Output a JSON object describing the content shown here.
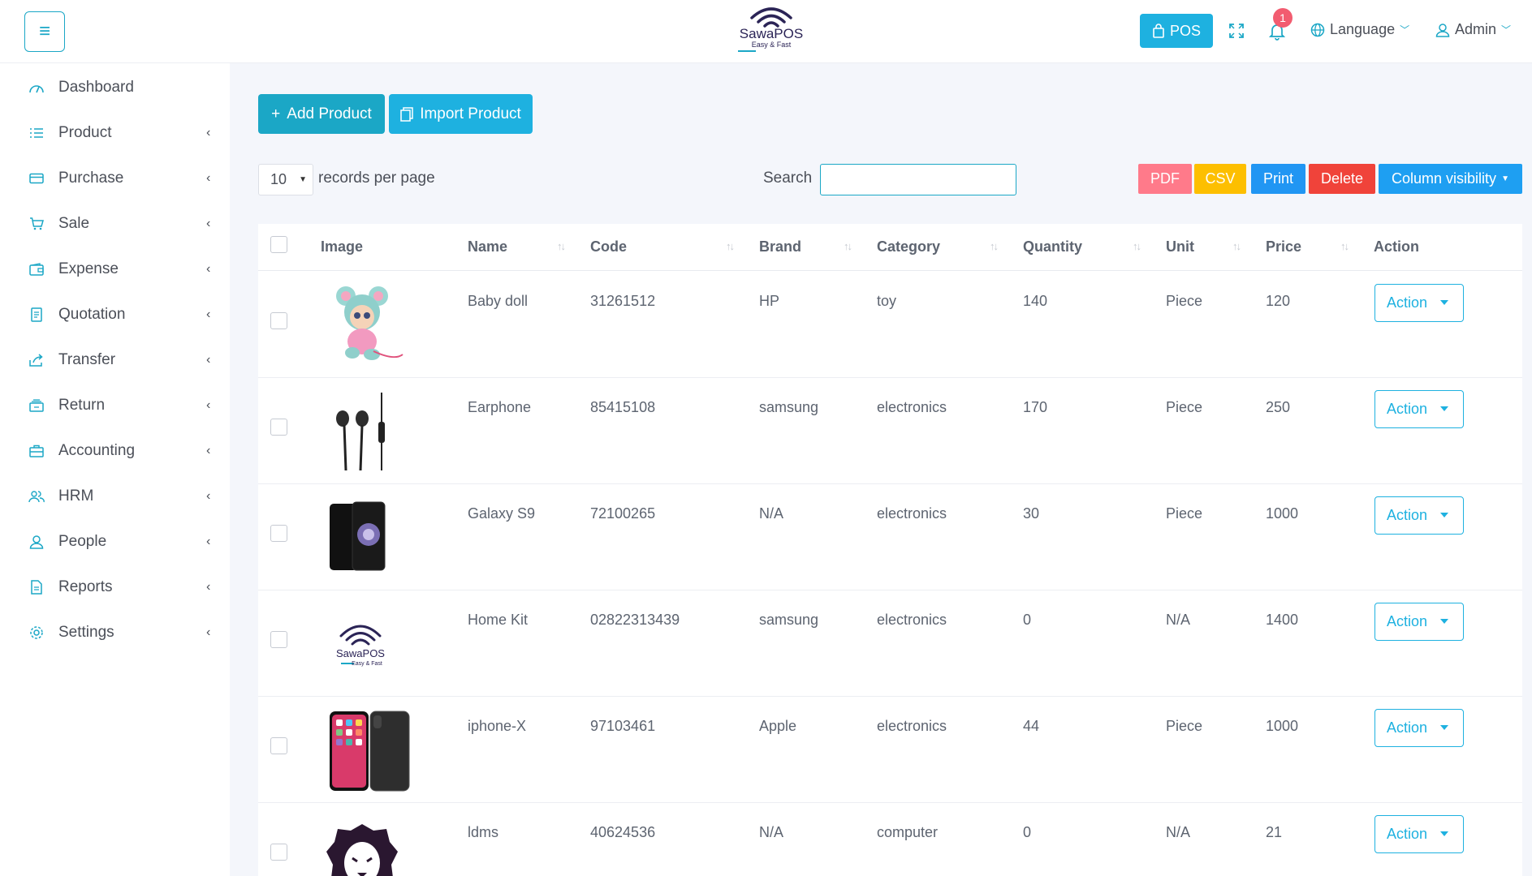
{
  "header": {
    "logo_text": "SawaPOS",
    "logo_tagline": "Easy & Fast",
    "pos_label": "POS",
    "notification_count": "1",
    "language_label": "Language",
    "user_label": "Admin"
  },
  "sidebar": {
    "items": [
      {
        "label": "Dashboard",
        "icon": "dashboard-icon"
      },
      {
        "label": "Product",
        "icon": "list-icon"
      },
      {
        "label": "Purchase",
        "icon": "card-icon"
      },
      {
        "label": "Sale",
        "icon": "cart-icon"
      },
      {
        "label": "Expense",
        "icon": "wallet-icon"
      },
      {
        "label": "Quotation",
        "icon": "document-icon"
      },
      {
        "label": "Transfer",
        "icon": "share-icon"
      },
      {
        "label": "Return",
        "icon": "inbox-icon"
      },
      {
        "label": "Accounting",
        "icon": "briefcase-icon"
      },
      {
        "label": "HRM",
        "icon": "users-icon"
      },
      {
        "label": "People",
        "icon": "user-icon"
      },
      {
        "label": "Reports",
        "icon": "file-icon"
      },
      {
        "label": "Settings",
        "icon": "gear-icon"
      }
    ]
  },
  "toolbar": {
    "add_product": "Add Product",
    "import_product": "Import Product",
    "records_per_page_value": "10",
    "records_per_page_label": "records per page",
    "search_label": "Search",
    "search_value": "",
    "pdf": "PDF",
    "csv": "CSV",
    "print": "Print",
    "delete": "Delete",
    "column_visibility": "Column visibility"
  },
  "table": {
    "headers": {
      "image": "Image",
      "name": "Name",
      "code": "Code",
      "brand": "Brand",
      "category": "Category",
      "quantity": "Quantity",
      "unit": "Unit",
      "price": "Price",
      "action": "Action"
    },
    "rows": [
      {
        "image": "baby-doll-image",
        "name": "Baby doll",
        "code": "31261512",
        "brand": "HP",
        "category": "toy",
        "quantity": "140",
        "unit": "Piece",
        "price": "120",
        "action": "Action"
      },
      {
        "image": "earphone-image",
        "name": "Earphone",
        "code": "85415108",
        "brand": "samsung",
        "category": "electronics",
        "quantity": "170",
        "unit": "Piece",
        "price": "250",
        "action": "Action"
      },
      {
        "image": "galaxy-s9-image",
        "name": "Galaxy S9",
        "code": "72100265",
        "brand": "N/A",
        "category": "electronics",
        "quantity": "30",
        "unit": "Piece",
        "price": "1000",
        "action": "Action"
      },
      {
        "image": "sawapos-logo-image",
        "name": "Home Kit",
        "code": "02822313439",
        "brand": "samsung",
        "category": "electronics",
        "quantity": "0",
        "unit": "N/A",
        "price": "1400",
        "action": "Action"
      },
      {
        "image": "iphone-x-image",
        "name": "iphone-X",
        "code": "97103461",
        "brand": "Apple",
        "category": "electronics",
        "quantity": "44",
        "unit": "Piece",
        "price": "1000",
        "action": "Action"
      },
      {
        "image": "lion-logo-image",
        "name": "ldms",
        "code": "40624536",
        "brand": "N/A",
        "category": "computer",
        "quantity": "0",
        "unit": "N/A",
        "price": "21",
        "action": "Action"
      }
    ]
  },
  "colors": {
    "accent": "#1ba7c6",
    "pos": "#1eb1e0",
    "pdf": "#ff7a8a",
    "csv": "#fdbf00",
    "print": "#2196f3",
    "delete": "#f0433a",
    "column_visibility": "#1e9ff2",
    "badge": "#f25c70"
  }
}
